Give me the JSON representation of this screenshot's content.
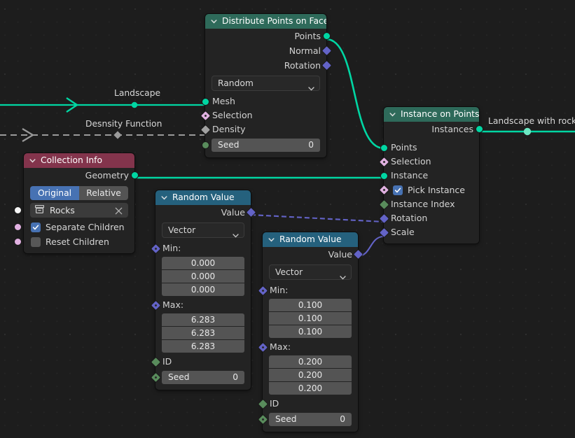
{
  "editor": {
    "background_color": "#1d1d1d",
    "grid_dot_color": "#2e2e2e"
  },
  "link_labels": {
    "landscape": "Landscape",
    "density_function": "Desnsity  Function",
    "landscape_with_rocks": "Landscape with rocks"
  },
  "nodes": {
    "distribute_points_on_faces": {
      "title": "Distribute Points on Faces",
      "header_color": "#2e6a5a",
      "outputs": [
        {
          "label": "Points",
          "socket": "geometry",
          "color": "#00d6a3"
        },
        {
          "label": "Normal",
          "socket": "vector",
          "color": "#6363c7"
        },
        {
          "label": "Rotation",
          "socket": "vector",
          "color": "#6363c7"
        }
      ],
      "method_dropdown": "Random",
      "inputs": [
        {
          "label": "Mesh",
          "socket": "geometry",
          "color": "#00d6a3"
        },
        {
          "label": "Selection",
          "socket": "field-bool",
          "color": "#e1b1e1"
        },
        {
          "label": "Density",
          "socket": "field-float",
          "color": "#a1a1a1"
        }
      ],
      "seed": {
        "label": "Seed",
        "value": "0"
      }
    },
    "collection_info": {
      "title": "Collection Info",
      "header_color": "#83344c",
      "outputs": [
        {
          "label": "Geometry",
          "socket": "geometry",
          "color": "#00d6a3"
        }
      ],
      "transform_space": {
        "options": [
          "Original",
          "Relative"
        ],
        "selected": "Original"
      },
      "collection_field": {
        "value": "Rocks",
        "icon": "collection-icon",
        "clear_icon": "x-icon"
      },
      "checkboxes": [
        {
          "label": "Separate Children",
          "checked": true,
          "socket_color": "#e1b1e1"
        },
        {
          "label": "Reset Children",
          "checked": false,
          "socket_color": "#e1b1e1"
        }
      ],
      "collection_socket_color": "#f5f5f5"
    },
    "random_value_1": {
      "title": "Random Value",
      "header_color": "#25617d",
      "outputs": [
        {
          "label": "Value",
          "socket": "vector",
          "color": "#6363c7"
        }
      ],
      "data_type": "Vector",
      "min_label": "Min:",
      "min": [
        "0.000",
        "0.000",
        "0.000"
      ],
      "max_label": "Max:",
      "max": [
        "6.283",
        "6.283",
        "6.283"
      ],
      "id_label": "ID",
      "seed": {
        "label": "Seed",
        "value": "0"
      }
    },
    "random_value_2": {
      "title": "Random Value",
      "header_color": "#25617d",
      "outputs": [
        {
          "label": "Value",
          "socket": "vector",
          "color": "#6363c7"
        }
      ],
      "data_type": "Vector",
      "min_label": "Min:",
      "min": [
        "0.100",
        "0.100",
        "0.100"
      ],
      "max_label": "Max:",
      "max": [
        "0.200",
        "0.200",
        "0.200"
      ],
      "id_label": "ID",
      "seed": {
        "label": "Seed",
        "value": "0"
      }
    },
    "instance_on_points": {
      "title": "Instance on Points",
      "header_color": "#2e6a5a",
      "outputs": [
        {
          "label": "Instances",
          "socket": "geometry",
          "color": "#00d6a3"
        }
      ],
      "inputs": [
        {
          "label": "Points",
          "socket": "geometry",
          "color": "#00d6a3"
        },
        {
          "label": "Selection",
          "socket": "field-bool",
          "color": "#e1b1e1"
        },
        {
          "label": "Instance",
          "socket": "geometry",
          "color": "#00d6a3"
        },
        {
          "label": "Instance Index",
          "socket": "field-int",
          "color": "#598c5c"
        },
        {
          "label": "Rotation",
          "socket": "vector",
          "color": "#6363c7"
        },
        {
          "label": "Scale",
          "socket": "vector",
          "color": "#6363c7"
        }
      ],
      "pick_instance": {
        "label": "Pick Instance",
        "checked": true,
        "socket_color": "#e1b1e1"
      }
    }
  },
  "links": {
    "wire_green": "#00d6a3",
    "wire_grey": "#9a9a9a",
    "wire_purple": "#6363c7"
  }
}
